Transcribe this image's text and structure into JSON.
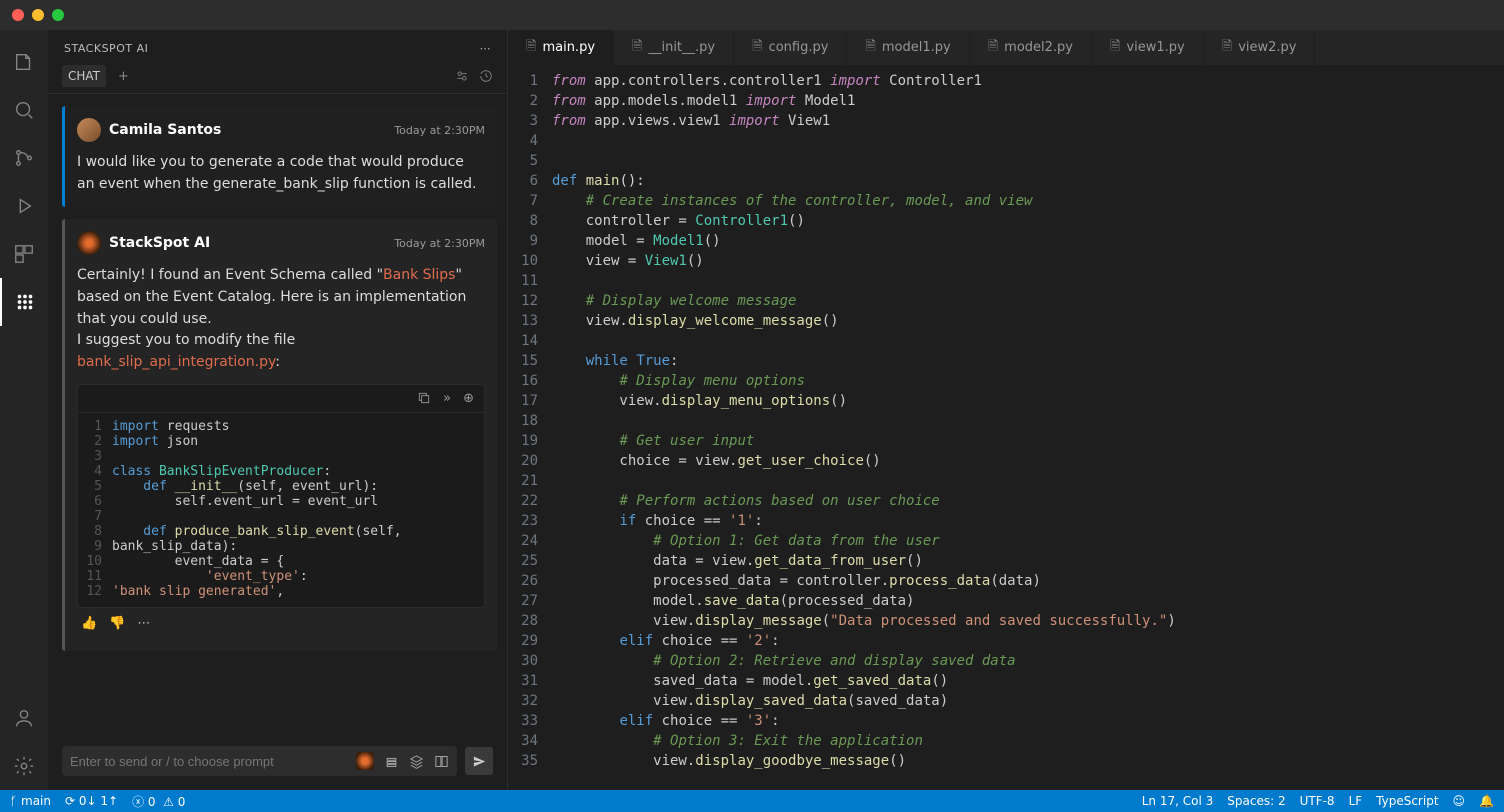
{
  "sidebar": {
    "title": "STACKSPOT AI",
    "tab_label": "CHAT"
  },
  "chat": {
    "user_name": "Camila Santos",
    "user_time": "Today at 2:30PM",
    "user_body": "I would like you to generate a code that would produce an event when the generate_bank_slip function is called.",
    "ai_name": "StackSpot AI",
    "ai_time": "Today at 2:30PM",
    "ai_l1a": "Certainly! I found an Event Schema called \"",
    "ai_l1b": "Bank Slips",
    "ai_l1c": "\" based on the Event Catalog. Here is an implementation that you could use.",
    "ai_l2a": "I suggest you to modify the file ",
    "ai_l2b": "bank_slip_api_integration.py",
    "ai_l2c": ":"
  },
  "snippet": [
    {
      "n": "1",
      "t": "import",
      "rest": " requests"
    },
    {
      "n": "2",
      "t": "import",
      "rest": " json"
    },
    {
      "n": "3",
      "t": "",
      "rest": ""
    },
    {
      "n": "4",
      "t": "class",
      "cls": " BankSlipEventProducer",
      "rest": ":"
    },
    {
      "n": "5",
      "t": "    def",
      "fn": " __init__",
      "rest": "(self, event_url):"
    },
    {
      "n": "6",
      "rest": "        self.event_url = event_url"
    },
    {
      "n": "7",
      "rest": ""
    },
    {
      "n": "8",
      "t": "    def",
      "fn": " produce_bank_slip_event",
      "rest": "(self,"
    },
    {
      "n": "9",
      "rest": "bank_slip_data):"
    },
    {
      "n": "10",
      "rest": "        event_data = {"
    },
    {
      "n": "11",
      "rest": "            'event_type':"
    },
    {
      "n": "12",
      "rest": "'bank slip generated',"
    }
  ],
  "input": {
    "placeholder": "Enter to send or / to choose prompt"
  },
  "tabs": [
    {
      "label": "main.py",
      "active": true
    },
    {
      "label": "__init__.py",
      "active": false
    },
    {
      "label": "config.py",
      "active": false
    },
    {
      "label": "model1.py",
      "active": false
    },
    {
      "label": "model2.py",
      "active": false
    },
    {
      "label": "view1.py",
      "active": false
    },
    {
      "label": "view2.py",
      "active": false
    }
  ],
  "code": [
    {
      "n": 1,
      "h": "<span class='tok-import-kw'>from</span> app.controllers.controller1 <span class='tok-import-kw'>import</span> Controller1"
    },
    {
      "n": 2,
      "h": "<span class='tok-import-kw'>from</span> app.models.model1 <span class='tok-import-kw'>import</span> Model1"
    },
    {
      "n": 3,
      "h": "<span class='tok-import-kw'>from</span> app.views.view1 <span class='tok-import-kw'>import</span> View1"
    },
    {
      "n": 4,
      "h": ""
    },
    {
      "n": 5,
      "h": ""
    },
    {
      "n": 6,
      "h": "<span class='tok-def'>def</span> <span class='tok-call'>main</span><span class='tok-paren'>():</span>"
    },
    {
      "n": 7,
      "h": "    <span class='tok-com'># Create instances of the controller, model, and view</span>"
    },
    {
      "n": 8,
      "h": "    controller = <span class='tok-type'>Controller1</span>()"
    },
    {
      "n": 9,
      "h": "    model = <span class='tok-type'>Model1</span>()"
    },
    {
      "n": 10,
      "h": "    view = <span class='tok-type'>View1</span>()"
    },
    {
      "n": 11,
      "h": ""
    },
    {
      "n": 12,
      "h": "    <span class='tok-com'># Display welcome message</span>"
    },
    {
      "n": 13,
      "h": "    view.<span class='tok-call'>display_welcome_message</span>()"
    },
    {
      "n": 14,
      "h": ""
    },
    {
      "n": 15,
      "h": "    <span class='tok-def'>while</span> <span class='tok-def'>True</span>:"
    },
    {
      "n": 16,
      "h": "        <span class='tok-com'># Display menu options</span>"
    },
    {
      "n": 17,
      "h": "        view.<span class='tok-call'>display_menu_options</span>()"
    },
    {
      "n": 18,
      "h": ""
    },
    {
      "n": 19,
      "h": "        <span class='tok-com'># Get user input</span>"
    },
    {
      "n": 20,
      "h": "        choice = view.<span class='tok-call'>get_user_choice</span>()"
    },
    {
      "n": 21,
      "h": ""
    },
    {
      "n": 22,
      "h": "        <span class='tok-com'># Perform actions based on user choice</span>"
    },
    {
      "n": 23,
      "h": "        <span class='tok-def'>if</span> choice == <span class='tok-str'>'1'</span>:"
    },
    {
      "n": 24,
      "h": "            <span class='tok-com'># Option 1: Get data from the user</span>"
    },
    {
      "n": 25,
      "h": "            data = view.<span class='tok-call'>get_data_from_user</span>()"
    },
    {
      "n": 26,
      "h": "            processed_data = controller.<span class='tok-call'>process_data</span>(data)"
    },
    {
      "n": 27,
      "h": "            model.<span class='tok-call'>save_data</span>(processed_data)"
    },
    {
      "n": 28,
      "h": "            view.<span class='tok-call'>display_message</span>(<span class='tok-str'>\"Data processed and saved successfully.\"</span>)"
    },
    {
      "n": 29,
      "h": "        <span class='tok-def'>elif</span> choice == <span class='tok-str'>'2'</span>:"
    },
    {
      "n": 30,
      "h": "            <span class='tok-com'># Option 2: Retrieve and display saved data</span>"
    },
    {
      "n": 31,
      "h": "            saved_data = model.<span class='tok-call'>get_saved_data</span>()"
    },
    {
      "n": 32,
      "h": "            view.<span class='tok-call'>display_saved_data</span>(saved_data)"
    },
    {
      "n": 33,
      "h": "        <span class='tok-def'>elif</span> choice == <span class='tok-str'>'3'</span>:"
    },
    {
      "n": 34,
      "h": "            <span class='tok-com'># Option 3: Exit the application</span>"
    },
    {
      "n": 35,
      "h": "            view.<span class='tok-call'>display_goodbye_message</span>()"
    }
  ],
  "status": {
    "branch": "main",
    "sync": "0↓ 1↑",
    "errors": "0",
    "warnings": "0",
    "ln_col": "Ln 17, Col 3",
    "spaces": "Spaces: 2",
    "encoding": "UTF-8",
    "eol": "LF",
    "lang": "TypeScript"
  }
}
